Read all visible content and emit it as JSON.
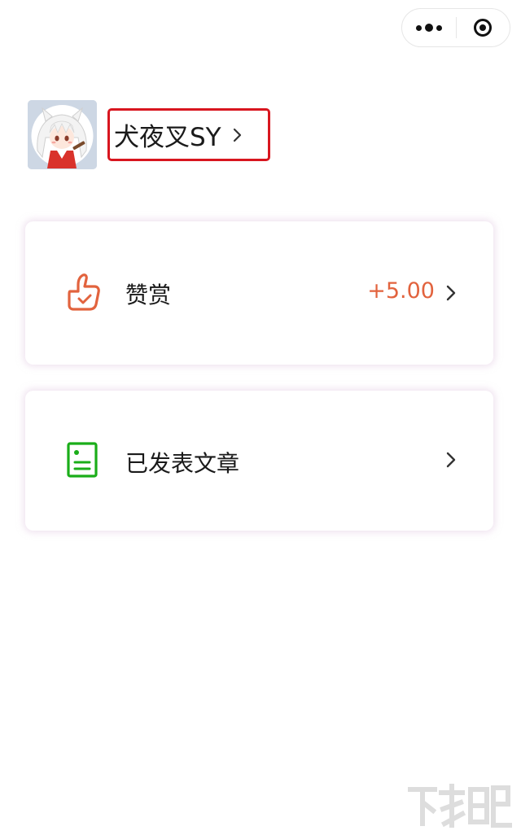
{
  "capsule": {
    "more_icon": "more-dots-icon",
    "close_icon": "target-circle-icon"
  },
  "profile": {
    "avatar_icon": "anime-character-avatar",
    "name": "犬夜叉SY",
    "highlight_color": "#d8161f"
  },
  "menu": [
    {
      "icon": "thumbs-up-icon",
      "label": "赞赏",
      "value": "+5.00",
      "icon_color": "#e2633e",
      "value_color": "#e2633e"
    },
    {
      "icon": "document-icon",
      "label": "已发表文章",
      "value": "",
      "icon_color": "#1aad19"
    }
  ],
  "watermark": {
    "icon": "site-logo-watermark"
  }
}
